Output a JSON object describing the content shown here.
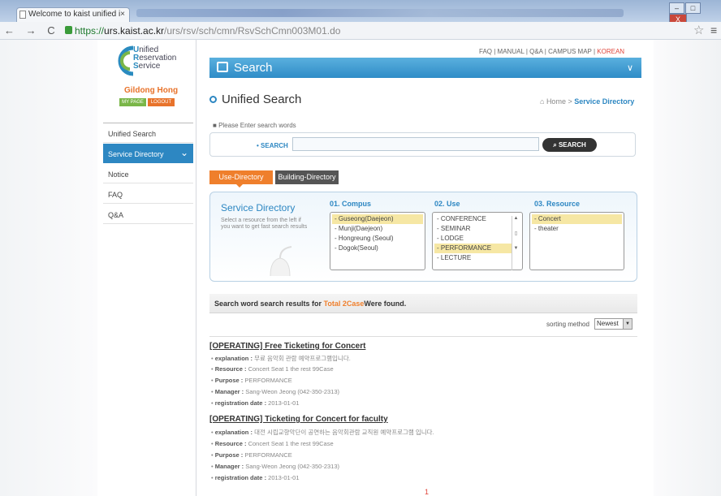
{
  "browser": {
    "tab_title": "Welcome to kaist unified i",
    "tab_close": "×",
    "url_scheme": "https://",
    "url_host": "urs.kaist.ac.kr",
    "url_path": "/urs/rsv/sch/cmn/RsvSchCmn003M01.do",
    "nav_buttons": "← → C",
    "win_buttons": [
      "–",
      "□",
      "X"
    ]
  },
  "sidebar": {
    "logo": [
      "U",
      "nified",
      "R",
      "eservation",
      "S",
      "ervice"
    ],
    "user_name": "Gildong Hong",
    "mypage_label": "MY PAGE",
    "logout_label": "LOGOUT",
    "items": [
      {
        "label": "Unified Search"
      },
      {
        "label": "Service Directory",
        "active": true
      },
      {
        "label": "Notice"
      },
      {
        "label": "FAQ"
      },
      {
        "label": "Q&A"
      }
    ]
  },
  "header": {
    "top_menu": [
      "FAQ",
      "MANUAL",
      "Q&A",
      "CAMPUS MAP",
      "KOREAN"
    ],
    "banner_title": "Search",
    "page_title": "Unified Search",
    "breadcrumb_home": "Home",
    "breadcrumb_current": "Service Directory"
  },
  "search": {
    "instruction": "Please Enter search words",
    "label": "SEARCH",
    "value": "",
    "button": "SEARCH"
  },
  "tabs": {
    "use": "Use-Directory",
    "building": "Building-Directory"
  },
  "directory": {
    "title": "Service Directory",
    "description": "Select a resource from the left if you want to get fast search results",
    "col1": {
      "heading": "01. Compus",
      "items": [
        "Guseong(Daejeon)",
        "Munji(Daejeon)",
        "Hongreung (Seoul)",
        "Dogok(Seoul)"
      ],
      "selected": 0
    },
    "col2": {
      "heading": "02. Use",
      "items": [
        "CONFERENCE",
        "SEMINAR",
        "LODGE",
        "PERFORMANCE",
        "LECTURE"
      ],
      "selected": 3
    },
    "col3": {
      "heading": "03. Resource",
      "items": [
        "Concert",
        "theater"
      ],
      "selected": 0
    }
  },
  "results": {
    "summary_prefix": "Search word search results for ",
    "summary_count": "Total 2Case",
    "summary_suffix": "Were found.",
    "sort_label": "sorting method",
    "sort_value": "Newest",
    "field_labels": {
      "explanation": "explanation :",
      "resource": "Resource :",
      "purpose": "Purpose :",
      "manager": "Manager :",
      "date": "registration date :"
    },
    "items": [
      {
        "title": "[OPERATING]  Free Ticketing for Concert",
        "explanation": "무료 음악회 관람 예약프로그램입니다.",
        "resource": "Concert Seat 1 the rest 99Case",
        "purpose": "PERFORMANCE",
        "manager": "Sang-Weon Jeong (042-350-2313)",
        "date": "2013-01-01"
      },
      {
        "title": "[OPERATING]  Ticketing for Concert for faculty",
        "explanation": "대전 시립교향악단이 공연하는 음악회관람 교직원 예약프로그램 입니다.",
        "resource": "Concert Seat 1 the rest 99Case",
        "purpose": "PERFORMANCE",
        "manager": "Sang-Weon Jeong (042-350-2313)",
        "date": "2013-01-01"
      }
    ],
    "page": "1"
  },
  "colors": {
    "accent": "#2d87c2",
    "orange": "#ef7f2c",
    "green": "#7ab648",
    "red": "#e0453a"
  }
}
